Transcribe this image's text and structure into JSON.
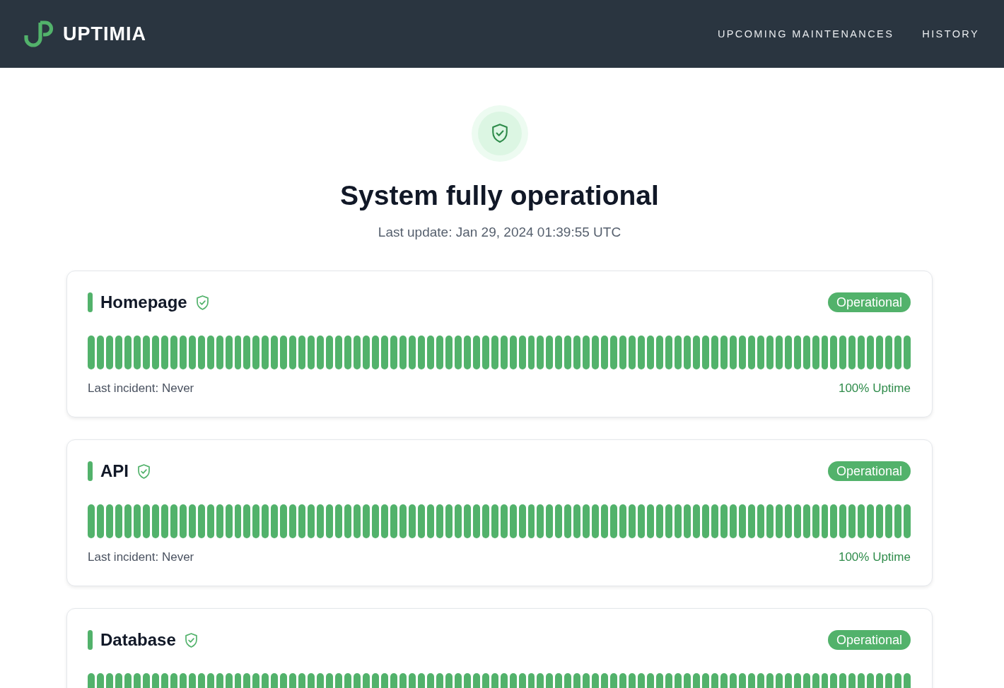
{
  "header": {
    "logo": "UPTIMIA",
    "nav": [
      "UPCOMING MAINTENANCES",
      "HISTORY"
    ]
  },
  "summary": {
    "operational": true,
    "title": "System fully operational",
    "last_update": "Last update: Jan 29, 2024 01:39:55 UTC"
  },
  "monitors": [
    {
      "name": "Homepage",
      "operational": true,
      "badge": "Operational",
      "days": [
        {
          "color": "#52b26b"
        },
        {
          "color": "#52b26b"
        },
        {
          "color": "#52b26b"
        },
        {
          "color": "#52b26b"
        },
        {
          "color": "#52b26b"
        },
        {
          "color": "#52b26b"
        },
        {
          "color": "#52b26b"
        },
        {
          "color": "#52b26b"
        },
        {
          "color": "#52b26b"
        },
        {
          "color": "#52b26b"
        },
        {
          "color": "#52b26b"
        },
        {
          "color": "#52b26b"
        },
        {
          "color": "#52b26b"
        },
        {
          "color": "#52b26b"
        },
        {
          "color": "#52b26b"
        },
        {
          "color": "#52b26b"
        },
        {
          "color": "#52b26b"
        },
        {
          "color": "#52b26b"
        },
        {
          "color": "#52b26b"
        },
        {
          "color": "#52b26b"
        },
        {
          "color": "#52b26b"
        },
        {
          "color": "#52b26b"
        },
        {
          "color": "#52b26b"
        },
        {
          "color": "#52b26b"
        },
        {
          "color": "#52b26b"
        },
        {
          "color": "#52b26b"
        },
        {
          "color": "#52b26b"
        },
        {
          "color": "#52b26b"
        },
        {
          "color": "#52b26b"
        },
        {
          "color": "#52b26b"
        },
        {
          "color": "#52b26b"
        },
        {
          "color": "#52b26b"
        },
        {
          "color": "#52b26b"
        },
        {
          "color": "#52b26b"
        },
        {
          "color": "#52b26b"
        },
        {
          "color": "#52b26b"
        },
        {
          "color": "#52b26b"
        },
        {
          "color": "#52b26b"
        },
        {
          "color": "#52b26b"
        },
        {
          "color": "#52b26b"
        },
        {
          "color": "#52b26b"
        },
        {
          "color": "#52b26b"
        },
        {
          "color": "#52b26b"
        },
        {
          "color": "#52b26b"
        },
        {
          "color": "#52b26b"
        },
        {
          "color": "#52b26b"
        },
        {
          "color": "#52b26b"
        },
        {
          "color": "#52b26b"
        },
        {
          "color": "#52b26b"
        },
        {
          "color": "#52b26b"
        },
        {
          "color": "#52b26b"
        },
        {
          "color": "#52b26b"
        },
        {
          "color": "#52b26b"
        },
        {
          "color": "#52b26b"
        },
        {
          "color": "#52b26b"
        },
        {
          "color": "#52b26b"
        },
        {
          "color": "#52b26b"
        },
        {
          "color": "#52b26b"
        },
        {
          "color": "#52b26b"
        },
        {
          "color": "#52b26b"
        },
        {
          "color": "#52b26b"
        },
        {
          "color": "#52b26b"
        },
        {
          "color": "#52b26b"
        },
        {
          "color": "#52b26b"
        },
        {
          "color": "#52b26b"
        },
        {
          "color": "#52b26b"
        },
        {
          "color": "#52b26b"
        },
        {
          "color": "#52b26b"
        },
        {
          "color": "#52b26b"
        },
        {
          "color": "#52b26b"
        },
        {
          "color": "#52b26b"
        },
        {
          "color": "#52b26b"
        },
        {
          "color": "#52b26b"
        },
        {
          "color": "#52b26b"
        },
        {
          "color": "#52b26b"
        },
        {
          "color": "#52b26b"
        },
        {
          "color": "#52b26b"
        },
        {
          "color": "#52b26b"
        },
        {
          "color": "#52b26b"
        },
        {
          "color": "#52b26b"
        },
        {
          "color": "#52b26b"
        },
        {
          "color": "#52b26b"
        },
        {
          "color": "#52b26b"
        },
        {
          "color": "#52b26b"
        },
        {
          "color": "#52b26b"
        },
        {
          "color": "#52b26b"
        },
        {
          "color": "#52b26b"
        },
        {
          "color": "#52b26b"
        },
        {
          "color": "#52b26b"
        },
        {
          "color": "#52b26b"
        }
      ],
      "last_incident": "Last incident: Never",
      "uptime": "100% Uptime"
    },
    {
      "name": "API",
      "operational": true,
      "badge": "Operational",
      "days": [
        {
          "color": "#52b26b"
        },
        {
          "color": "#52b26b"
        },
        {
          "color": "#52b26b"
        },
        {
          "color": "#52b26b"
        },
        {
          "color": "#52b26b"
        },
        {
          "color": "#52b26b"
        },
        {
          "color": "#52b26b"
        },
        {
          "color": "#52b26b"
        },
        {
          "color": "#52b26b"
        },
        {
          "color": "#52b26b"
        },
        {
          "color": "#52b26b"
        },
        {
          "color": "#52b26b"
        },
        {
          "color": "#52b26b"
        },
        {
          "color": "#52b26b"
        },
        {
          "color": "#52b26b"
        },
        {
          "color": "#52b26b"
        },
        {
          "color": "#52b26b"
        },
        {
          "color": "#52b26b"
        },
        {
          "color": "#52b26b"
        },
        {
          "color": "#52b26b"
        },
        {
          "color": "#52b26b"
        },
        {
          "color": "#52b26b"
        },
        {
          "color": "#52b26b"
        },
        {
          "color": "#52b26b"
        },
        {
          "color": "#52b26b"
        },
        {
          "color": "#52b26b"
        },
        {
          "color": "#52b26b"
        },
        {
          "color": "#52b26b"
        },
        {
          "color": "#52b26b"
        },
        {
          "color": "#52b26b"
        },
        {
          "color": "#52b26b"
        },
        {
          "color": "#52b26b"
        },
        {
          "color": "#52b26b"
        },
        {
          "color": "#52b26b"
        },
        {
          "color": "#52b26b"
        },
        {
          "color": "#52b26b"
        },
        {
          "color": "#52b26b"
        },
        {
          "color": "#52b26b"
        },
        {
          "color": "#52b26b"
        },
        {
          "color": "#52b26b"
        },
        {
          "color": "#52b26b"
        },
        {
          "color": "#52b26b"
        },
        {
          "color": "#52b26b"
        },
        {
          "color": "#52b26b"
        },
        {
          "color": "#52b26b"
        },
        {
          "color": "#52b26b"
        },
        {
          "color": "#52b26b"
        },
        {
          "color": "#52b26b"
        },
        {
          "color": "#52b26b"
        },
        {
          "color": "#52b26b"
        },
        {
          "color": "#52b26b"
        },
        {
          "color": "#52b26b"
        },
        {
          "color": "#52b26b"
        },
        {
          "color": "#52b26b"
        },
        {
          "color": "#52b26b"
        },
        {
          "color": "#52b26b"
        },
        {
          "color": "#52b26b"
        },
        {
          "color": "#52b26b"
        },
        {
          "color": "#52b26b"
        },
        {
          "color": "#52b26b"
        },
        {
          "color": "#52b26b"
        },
        {
          "color": "#52b26b"
        },
        {
          "color": "#52b26b"
        },
        {
          "color": "#52b26b"
        },
        {
          "color": "#52b26b"
        },
        {
          "color": "#52b26b"
        },
        {
          "color": "#52b26b"
        },
        {
          "color": "#52b26b"
        },
        {
          "color": "#52b26b"
        },
        {
          "color": "#52b26b"
        },
        {
          "color": "#52b26b"
        },
        {
          "color": "#52b26b"
        },
        {
          "color": "#52b26b"
        },
        {
          "color": "#52b26b"
        },
        {
          "color": "#52b26b"
        },
        {
          "color": "#52b26b"
        },
        {
          "color": "#52b26b"
        },
        {
          "color": "#52b26b"
        },
        {
          "color": "#52b26b"
        },
        {
          "color": "#52b26b"
        },
        {
          "color": "#52b26b"
        },
        {
          "color": "#52b26b"
        },
        {
          "color": "#52b26b"
        },
        {
          "color": "#52b26b"
        },
        {
          "color": "#52b26b"
        },
        {
          "color": "#52b26b"
        },
        {
          "color": "#52b26b"
        },
        {
          "color": "#52b26b"
        },
        {
          "color": "#52b26b"
        },
        {
          "color": "#52b26b"
        }
      ],
      "last_incident": "Last incident: Never",
      "uptime": "100% Uptime"
    },
    {
      "name": "Database",
      "operational": true,
      "badge": "Operational",
      "days": [
        {
          "color": "#52b26b"
        },
        {
          "color": "#52b26b"
        },
        {
          "color": "#52b26b"
        },
        {
          "color": "#52b26b"
        },
        {
          "color": "#52b26b"
        },
        {
          "color": "#52b26b"
        },
        {
          "color": "#52b26b"
        },
        {
          "color": "#52b26b"
        },
        {
          "color": "#52b26b"
        },
        {
          "color": "#52b26b"
        },
        {
          "color": "#52b26b"
        },
        {
          "color": "#52b26b"
        },
        {
          "color": "#52b26b"
        },
        {
          "color": "#52b26b"
        },
        {
          "color": "#52b26b"
        },
        {
          "color": "#52b26b"
        },
        {
          "color": "#52b26b"
        },
        {
          "color": "#52b26b"
        },
        {
          "color": "#52b26b"
        },
        {
          "color": "#52b26b"
        },
        {
          "color": "#52b26b"
        },
        {
          "color": "#52b26b"
        },
        {
          "color": "#52b26b"
        },
        {
          "color": "#52b26b"
        },
        {
          "color": "#52b26b"
        },
        {
          "color": "#52b26b"
        },
        {
          "color": "#52b26b"
        },
        {
          "color": "#52b26b"
        },
        {
          "color": "#52b26b"
        },
        {
          "color": "#52b26b"
        },
        {
          "color": "#52b26b"
        },
        {
          "color": "#52b26b"
        },
        {
          "color": "#52b26b"
        },
        {
          "color": "#52b26b"
        },
        {
          "color": "#52b26b"
        },
        {
          "color": "#52b26b"
        },
        {
          "color": "#52b26b"
        },
        {
          "color": "#52b26b"
        },
        {
          "color": "#52b26b"
        },
        {
          "color": "#52b26b"
        },
        {
          "color": "#52b26b"
        },
        {
          "color": "#52b26b"
        },
        {
          "color": "#52b26b"
        },
        {
          "color": "#52b26b"
        },
        {
          "color": "#52b26b"
        },
        {
          "color": "#52b26b"
        },
        {
          "color": "#52b26b"
        },
        {
          "color": "#52b26b"
        },
        {
          "color": "#52b26b"
        },
        {
          "color": "#52b26b"
        },
        {
          "color": "#52b26b"
        },
        {
          "color": "#52b26b"
        },
        {
          "color": "#52b26b"
        },
        {
          "color": "#52b26b"
        },
        {
          "color": "#52b26b"
        },
        {
          "color": "#52b26b"
        },
        {
          "color": "#52b26b"
        },
        {
          "color": "#52b26b"
        },
        {
          "color": "#52b26b"
        },
        {
          "color": "#52b26b"
        },
        {
          "color": "#52b26b"
        },
        {
          "color": "#52b26b"
        },
        {
          "color": "#52b26b"
        },
        {
          "color": "#52b26b"
        },
        {
          "color": "#52b26b"
        },
        {
          "color": "#52b26b"
        },
        {
          "color": "#52b26b"
        },
        {
          "color": "#52b26b"
        },
        {
          "color": "#52b26b"
        },
        {
          "color": "#52b26b"
        },
        {
          "color": "#52b26b"
        },
        {
          "color": "#52b26b"
        },
        {
          "color": "#52b26b"
        },
        {
          "color": "#52b26b"
        },
        {
          "color": "#52b26b"
        },
        {
          "color": "#52b26b"
        },
        {
          "color": "#52b26b"
        },
        {
          "color": "#52b26b"
        },
        {
          "color": "#52b26b"
        },
        {
          "color": "#52b26b"
        },
        {
          "color": "#52b26b"
        },
        {
          "color": "#52b26b"
        },
        {
          "color": "#52b26b"
        },
        {
          "color": "#52b26b"
        },
        {
          "color": "#52b26b"
        },
        {
          "color": "#52b26b"
        },
        {
          "color": "#52b26b"
        },
        {
          "color": "#52b26b"
        },
        {
          "color": "#52b26b"
        },
        {
          "color": "#52b26b"
        }
      ]
    }
  ]
}
